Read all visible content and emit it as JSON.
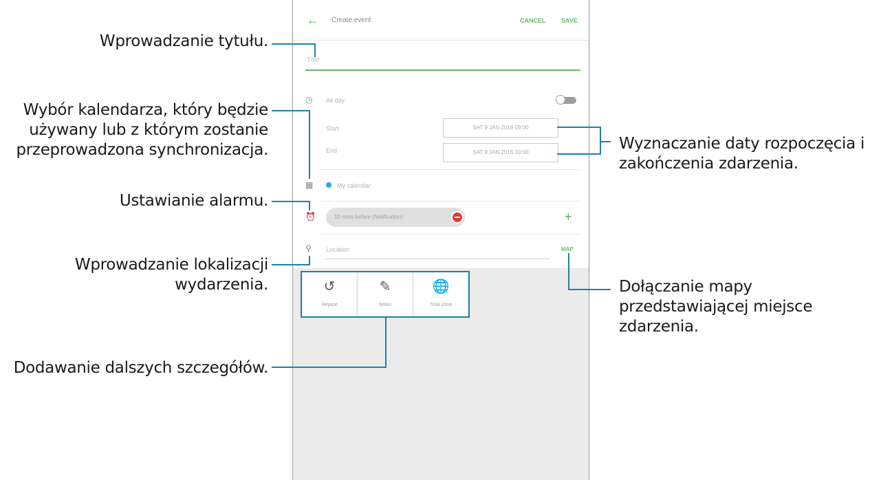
{
  "callouts": {
    "title": "Wprowadzanie tytułu.",
    "calendar": [
      "Wybór kalendarza, który będzie",
      "używany lub z którym zostanie",
      "przeprowadzona synchronizacja."
    ],
    "alarm": "Ustawianie alarmu.",
    "location": [
      "Wprowadzanie lokalizacji",
      "wydarzenia."
    ],
    "details": "Dodawanie dalszych szczegółów.",
    "dates": [
      "Wyznaczanie daty rozpoczęcia i",
      "zakończenia zdarzenia."
    ],
    "map": [
      "Dołączanie mapy",
      "przedstawiającej miejsce",
      "zdarzenia."
    ]
  },
  "app": {
    "title": "Create event",
    "cancel": "CANCEL",
    "save": "SAVE",
    "title_placeholder": "Title",
    "all_day": "All day",
    "start_label": "Start",
    "end_label": "End",
    "start_value": "SAT 9 JAN 2016   09:00",
    "end_value": "SAT 9 JAN 2016   10:00",
    "calendar": "My calendar",
    "alarm": "10 mins before (Notification)",
    "location_placeholder": "Location",
    "map": "MAP",
    "details": [
      {
        "label": "Repeat",
        "icon": "repeat-icon"
      },
      {
        "label": "Notes",
        "icon": "notes-icon"
      },
      {
        "label": "Time zone",
        "icon": "time-zone-icon"
      }
    ]
  },
  "colors": {
    "accent": "#4caf50",
    "leader_line": "#1f7fa6",
    "calendar_dot": "#29a8e0",
    "remove": "#e53935"
  }
}
